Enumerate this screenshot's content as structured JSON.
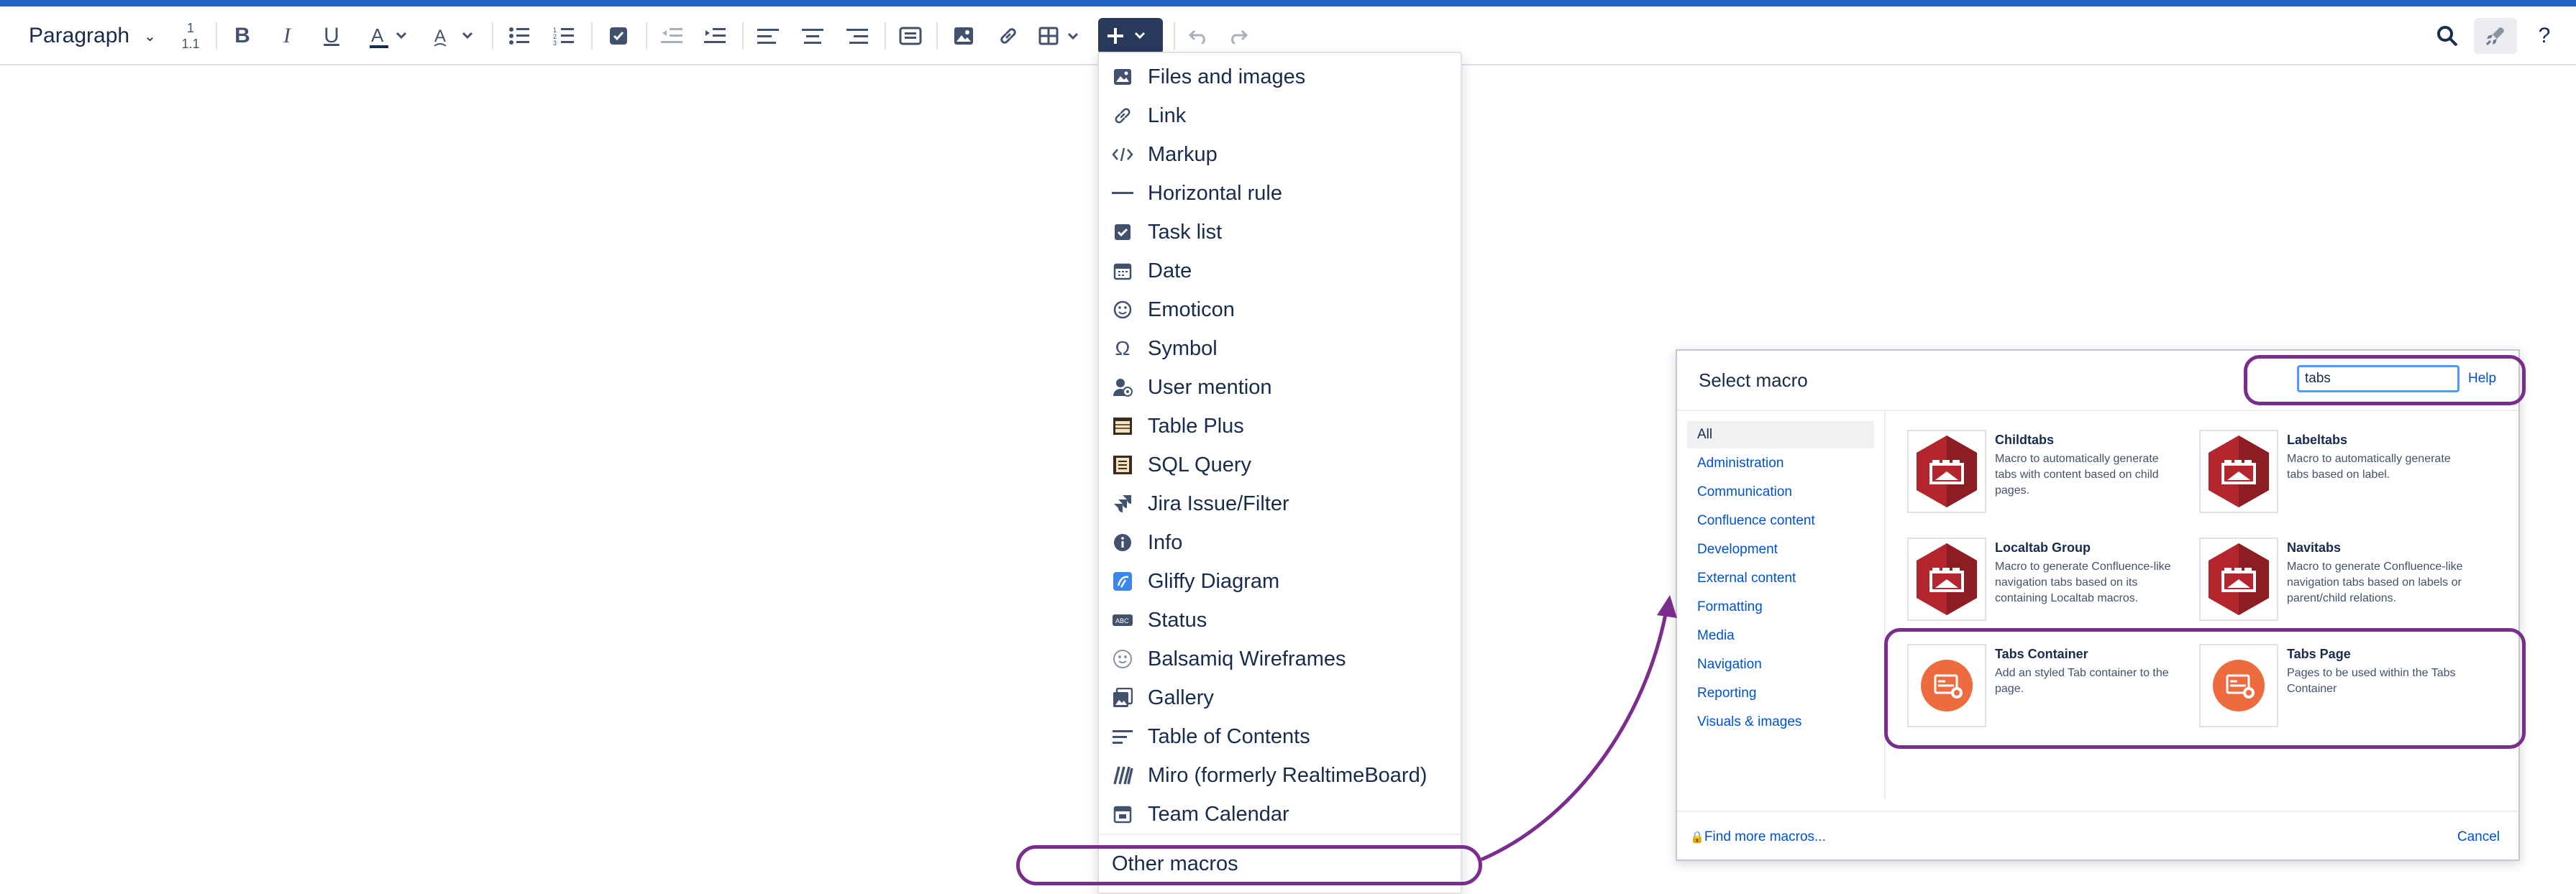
{
  "toolbar": {
    "paragraph_label": "Paragraph",
    "heading_numbering": [
      "1",
      "1.1"
    ],
    "buttons": [
      "bold-icon",
      "italic-icon",
      "underline-icon",
      "text-color-icon",
      "text-style-icon",
      "bullet-list-icon",
      "numbered-list-icon",
      "task-icon",
      "outdent-icon",
      "indent-icon",
      "align-left-icon",
      "align-center-icon",
      "align-right-icon",
      "layout-icon",
      "image-icon",
      "link-icon",
      "table-icon",
      "insert-plus-icon",
      "undo-icon",
      "redo-icon",
      "search-icon",
      "rocket-icon",
      "help-icon"
    ],
    "accent_color": "#2260c4"
  },
  "insert_menu": {
    "items": [
      {
        "label": "Files and images",
        "icon": "image-icon"
      },
      {
        "label": "Link",
        "icon": "link-icon"
      },
      {
        "label": "Markup",
        "icon": "code-icon"
      },
      {
        "label": "Horizontal rule",
        "icon": "hr-icon"
      },
      {
        "label": "Task list",
        "icon": "checkbox-icon"
      },
      {
        "label": "Date",
        "icon": "calendar-icon"
      },
      {
        "label": "Emoticon",
        "icon": "emoticon-icon"
      },
      {
        "label": "Symbol",
        "icon": "omega-icon"
      },
      {
        "label": "User mention",
        "icon": "user-icon"
      },
      {
        "label": "Table Plus",
        "icon": "table-plus-icon"
      },
      {
        "label": "SQL Query",
        "icon": "sql-icon"
      },
      {
        "label": "Jira Issue/Filter",
        "icon": "jira-icon"
      },
      {
        "label": "Info",
        "icon": "info-icon"
      },
      {
        "label": "Gliffy Diagram",
        "icon": "gliffy-icon"
      },
      {
        "label": "Status",
        "icon": "status-icon"
      },
      {
        "label": "Balsamiq Wireframes",
        "icon": "balsamiq-icon"
      },
      {
        "label": "Gallery",
        "icon": "gallery-icon"
      },
      {
        "label": "Table of Contents",
        "icon": "toc-icon"
      },
      {
        "label": "Miro (formerly RealtimeBoard)",
        "icon": "miro-icon"
      },
      {
        "label": "Team Calendar",
        "icon": "team-calendar-icon"
      }
    ],
    "other_label": "Other macros"
  },
  "macro_dialog": {
    "title": "Select macro",
    "search_value": "tabs",
    "help_label": "Help",
    "categories": [
      "All",
      "Administration",
      "Communication",
      "Confluence content",
      "Development",
      "External content",
      "Formatting",
      "Media",
      "Navigation",
      "Reporting",
      "Visuals & images"
    ],
    "active_category": "All",
    "macros": [
      {
        "name": "Childtabs",
        "desc": "Macro to automatically generate tabs with content based on child pages.",
        "style": "red-hex"
      },
      {
        "name": "Labeltabs",
        "desc": "Macro to automatically generate tabs based on label.",
        "style": "red-hex"
      },
      {
        "name": "Localtab Group",
        "desc": "Macro to generate Confluence-like navigation tabs based on its containing Localtab macros.",
        "style": "red-hex"
      },
      {
        "name": "Navitabs",
        "desc": "Macro to generate Confluence-like navigation tabs based on labels or parent/child relations.",
        "style": "red-hex"
      },
      {
        "name": "Tabs Container",
        "desc": "Add an styled Tab container to the page.",
        "style": "orange-circle"
      },
      {
        "name": "Tabs Page",
        "desc": "Pages to be used within the Tabs Container",
        "style": "orange-circle"
      }
    ],
    "find_more_label": "Find more macros...",
    "cancel_label": "Cancel"
  },
  "annotation_color": "#7b2d8e"
}
